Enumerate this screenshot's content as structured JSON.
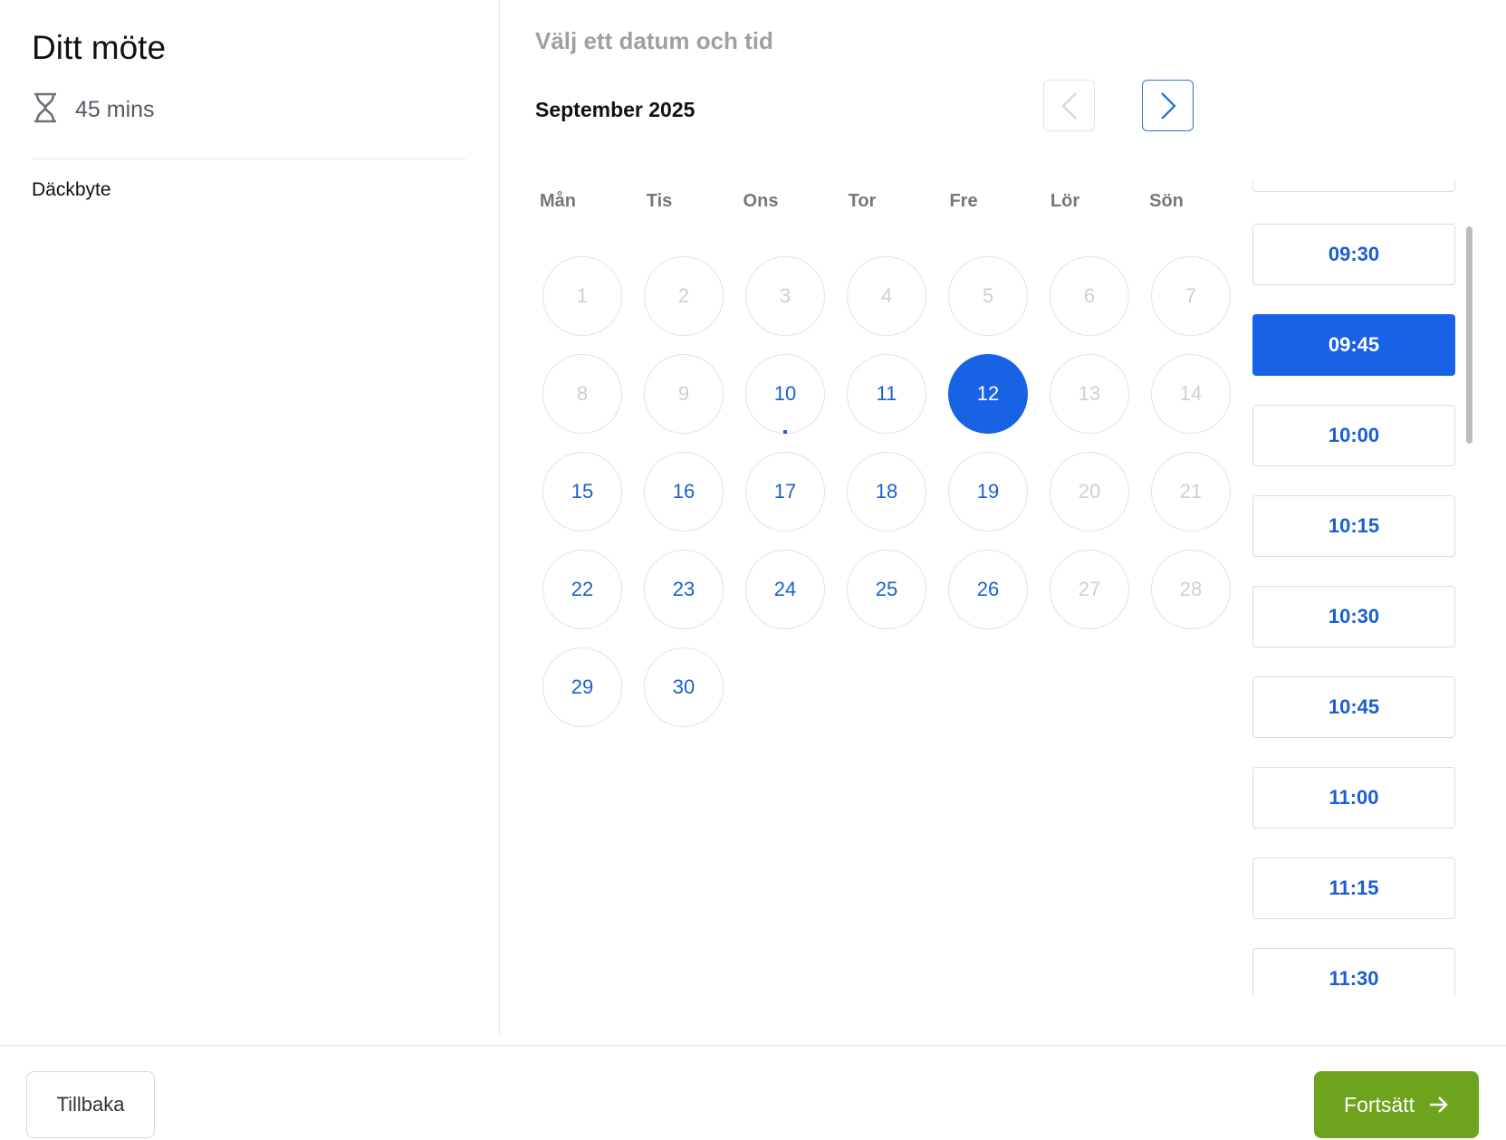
{
  "meeting": {
    "title": "Ditt möte",
    "duration": "45 mins",
    "service": "Däckbyte"
  },
  "calendar": {
    "heading": "Välj ett datum och tid",
    "month": "September 2025",
    "weekdays": [
      "Mån",
      "Tis",
      "Ons",
      "Tor",
      "Fre",
      "Lör",
      "Sön"
    ],
    "days": [
      {
        "label": "1",
        "state": "disabled"
      },
      {
        "label": "2",
        "state": "disabled"
      },
      {
        "label": "3",
        "state": "disabled"
      },
      {
        "label": "4",
        "state": "disabled"
      },
      {
        "label": "5",
        "state": "disabled"
      },
      {
        "label": "6",
        "state": "disabled"
      },
      {
        "label": "7",
        "state": "disabled"
      },
      {
        "label": "8",
        "state": "disabled"
      },
      {
        "label": "9",
        "state": "disabled"
      },
      {
        "label": "10",
        "state": "available",
        "today": true
      },
      {
        "label": "11",
        "state": "available"
      },
      {
        "label": "12",
        "state": "selected"
      },
      {
        "label": "13",
        "state": "disabled"
      },
      {
        "label": "14",
        "state": "disabled"
      },
      {
        "label": "15",
        "state": "available"
      },
      {
        "label": "16",
        "state": "available"
      },
      {
        "label": "17",
        "state": "available"
      },
      {
        "label": "18",
        "state": "available"
      },
      {
        "label": "19",
        "state": "available"
      },
      {
        "label": "20",
        "state": "disabled"
      },
      {
        "label": "21",
        "state": "disabled"
      },
      {
        "label": "22",
        "state": "available"
      },
      {
        "label": "23",
        "state": "available"
      },
      {
        "label": "24",
        "state": "available"
      },
      {
        "label": "25",
        "state": "available"
      },
      {
        "label": "26",
        "state": "available"
      },
      {
        "label": "27",
        "state": "disabled"
      },
      {
        "label": "28",
        "state": "disabled"
      },
      {
        "label": "29",
        "state": "available"
      },
      {
        "label": "30",
        "state": "available"
      }
    ]
  },
  "time_slots": [
    {
      "label": "09:30",
      "selected": false
    },
    {
      "label": "09:45",
      "selected": true
    },
    {
      "label": "10:00",
      "selected": false
    },
    {
      "label": "10:15",
      "selected": false
    },
    {
      "label": "10:30",
      "selected": false
    },
    {
      "label": "10:45",
      "selected": false
    },
    {
      "label": "11:00",
      "selected": false
    },
    {
      "label": "11:15",
      "selected": false
    },
    {
      "label": "11:30",
      "selected": false
    }
  ],
  "footer": {
    "back_label": "Tillbaka",
    "continue_label": "Fortsätt"
  },
  "colors": {
    "accent": "#1862e6",
    "link": "#1a5fd1",
    "continue": "#6ea31d",
    "disabled": "#cfcfcf"
  }
}
